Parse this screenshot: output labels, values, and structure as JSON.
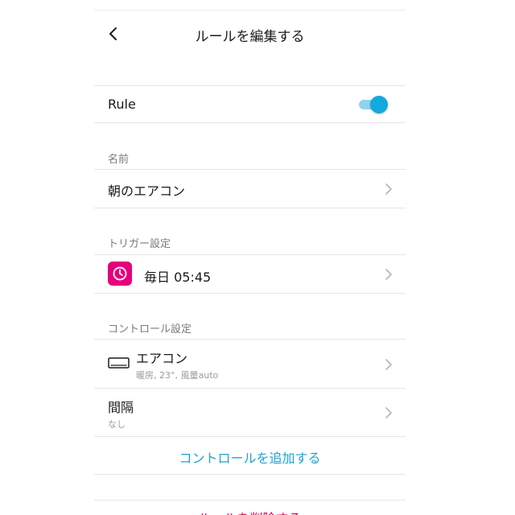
{
  "header": {
    "title": "ルールを編集する"
  },
  "rule": {
    "label": "Rule",
    "enabled": true
  },
  "name_section": {
    "label": "名前",
    "value": "朝のエアコン"
  },
  "trigger_section": {
    "label": "トリガー設定",
    "value": "毎日 05:45"
  },
  "control_section": {
    "label": "コントロール設定",
    "items": [
      {
        "title": "エアコン",
        "subtitle": "暖房, 23°, 風量auto"
      },
      {
        "title": "間隔",
        "subtitle": "なし"
      }
    ],
    "add_label": "コントロールを追加する"
  },
  "delete_label": "ルールを削除する",
  "colors": {
    "accent": "#14a9dc",
    "link": "#1fa3cf",
    "trigger_badge": "#e6007e",
    "danger": "#e4004f"
  },
  "icons": [
    "back-chevron-icon",
    "chevron-right-icon",
    "clock-icon",
    "air-conditioner-icon"
  ]
}
